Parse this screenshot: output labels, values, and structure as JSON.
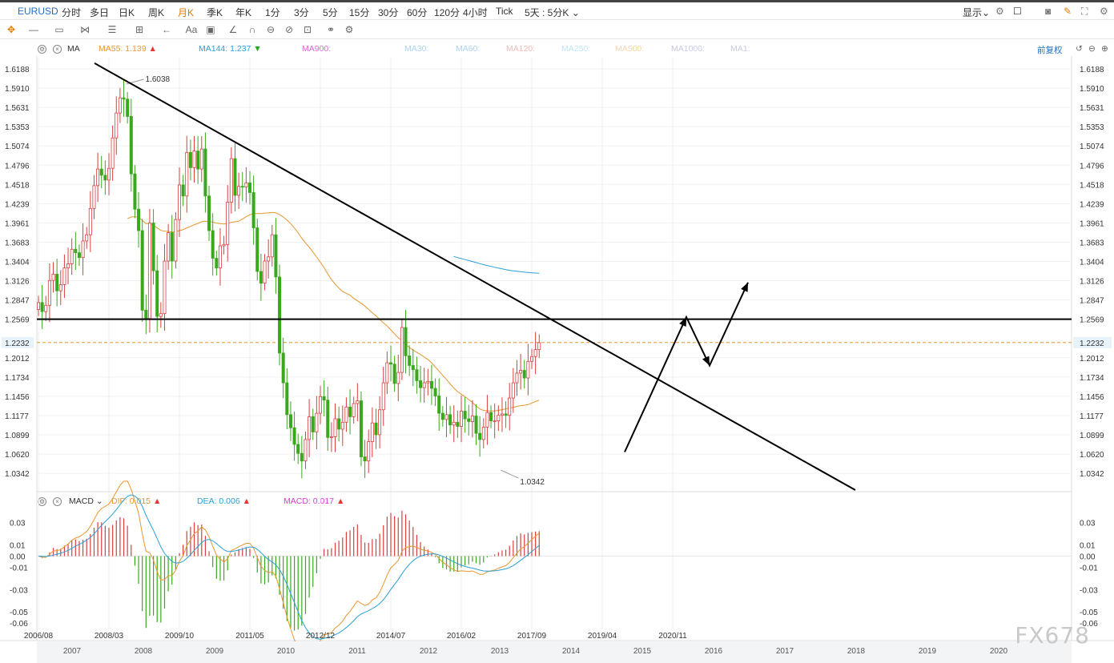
{
  "toolbar": {
    "symbol": "EURUSD",
    "periods": [
      "分时",
      "多日",
      "日K",
      "周K",
      "月K",
      "季K",
      "年K",
      "1分",
      "3分",
      "5分",
      "15分",
      "30分",
      "60分",
      "120分",
      "4小时",
      "Tick"
    ],
    "active_period": "月K",
    "range_select": "5天 : 5分K",
    "display_label": "显示"
  },
  "ma_legend": {
    "name": "MA",
    "items": [
      {
        "label": "MA55: 1.139",
        "color": "#e8962e",
        "arrow": "up"
      },
      {
        "label": "MA144: 1.237",
        "color": "#2aa0d8",
        "arrow": "down"
      },
      {
        "label": "MA900:",
        "color": "#d66ad6"
      },
      {
        "label": "MA30:",
        "color": "#a9d3ef"
      },
      {
        "label": "MA60:",
        "color": "#a9d3ef"
      },
      {
        "label": "MA120:",
        "color": "#f2b8b8"
      },
      {
        "label": "MA250:",
        "color": "#bfe5f5"
      },
      {
        "label": "MA500:",
        "color": "#f5d6a8"
      },
      {
        "label": "MA1000:",
        "color": "#c8c8e6"
      },
      {
        "label": "MA1:",
        "color": "#c8c8e6"
      }
    ],
    "adjust_label": "前复权"
  },
  "macd_legend": {
    "name": "MACD",
    "dif": "DIF: 0.015",
    "dea": "DEA: 0.006",
    "macd": "MACD: 0.017",
    "dif_color": "#e8962e",
    "dea_color": "#2aa0d8",
    "macd_color": "#d63ad6"
  },
  "chart_data": [
    {
      "type": "candlestick",
      "title": "EURUSD 月K",
      "y_ticks": [
        1.6188,
        1.591,
        1.5631,
        1.5353,
        1.5074,
        1.4796,
        1.4518,
        1.4239,
        1.3961,
        1.3683,
        1.3404,
        1.3126,
        1.2847,
        1.2569,
        1.2232,
        1.2012,
        1.1734,
        1.1456,
        1.1177,
        1.0899,
        1.062,
        1.0342
      ],
      "ylim": [
        1.01,
        1.635
      ],
      "current_price": 1.2232,
      "annotations": [
        {
          "text": "1.6038",
          "value": 1.6038,
          "date": "2008/07"
        },
        {
          "text": "1.0342",
          "value": 1.0342,
          "date": "2016/12"
        }
      ],
      "date_ticks": [
        "2006/08",
        "2008/03",
        "2009/10",
        "2011/05",
        "2012/12",
        "2014/07",
        "2016/02",
        "2017/09",
        "2019/04",
        "2020/11"
      ],
      "year_ticks": [
        "2007",
        "2008",
        "2009",
        "2010",
        "2011",
        "2012",
        "2013",
        "2014",
        "2015",
        "2016",
        "2017",
        "2018",
        "2019",
        "2020"
      ],
      "closes_monthly_from_2006_08": [
        1.281,
        1.268,
        1.277,
        1.313,
        1.322,
        1.298,
        1.307,
        1.331,
        1.337,
        1.358,
        1.353,
        1.346,
        1.37,
        1.379,
        1.417,
        1.45,
        1.474,
        1.465,
        1.458,
        1.475,
        1.519,
        1.555,
        1.577,
        1.575,
        1.55,
        1.467,
        1.416,
        1.385,
        1.27,
        1.258,
        1.396,
        1.327,
        1.261,
        1.265,
        1.341,
        1.382,
        1.341,
        1.401,
        1.451,
        1.435,
        1.498,
        1.476,
        1.5,
        1.474,
        1.503,
        1.435,
        1.385,
        1.345,
        1.331,
        1.363,
        1.365,
        1.426,
        1.489,
        1.436,
        1.449,
        1.448,
        1.454,
        1.44,
        1.389,
        1.326,
        1.309,
        1.341,
        1.347,
        1.379,
        1.318,
        1.208,
        1.165,
        1.119,
        1.1,
        1.076,
        1.063,
        1.052,
        1.083,
        1.116,
        1.094,
        1.121,
        1.145,
        1.14,
        1.086,
        1.087,
        1.113,
        1.098,
        1.108,
        1.13,
        1.116,
        1.135,
        1.139,
        1.058,
        1.052,
        1.08,
        1.107,
        1.09,
        1.126,
        1.165,
        1.194,
        1.192,
        1.164,
        1.18,
        1.245,
        1.204,
        1.19,
        1.184,
        1.168,
        1.158,
        1.165,
        1.167,
        1.157,
        1.146,
        1.121,
        1.112,
        1.119,
        1.104,
        1.108,
        1.102,
        1.124,
        1.113,
        1.109,
        1.117,
        1.092,
        1.083,
        1.101,
        1.122,
        1.11,
        1.11,
        1.118,
        1.12,
        1.118,
        1.143,
        1.165,
        1.179,
        1.183,
        1.172,
        1.196,
        1.203,
        1.213,
        1.223
      ]
    },
    {
      "type": "macd",
      "y_ticks": [
        0.03,
        0.01,
        0.0,
        -0.01,
        -0.03,
        -0.05,
        -0.06
      ],
      "ylim": [
        -0.065,
        0.042
      ]
    }
  ],
  "watermark": "FX678"
}
